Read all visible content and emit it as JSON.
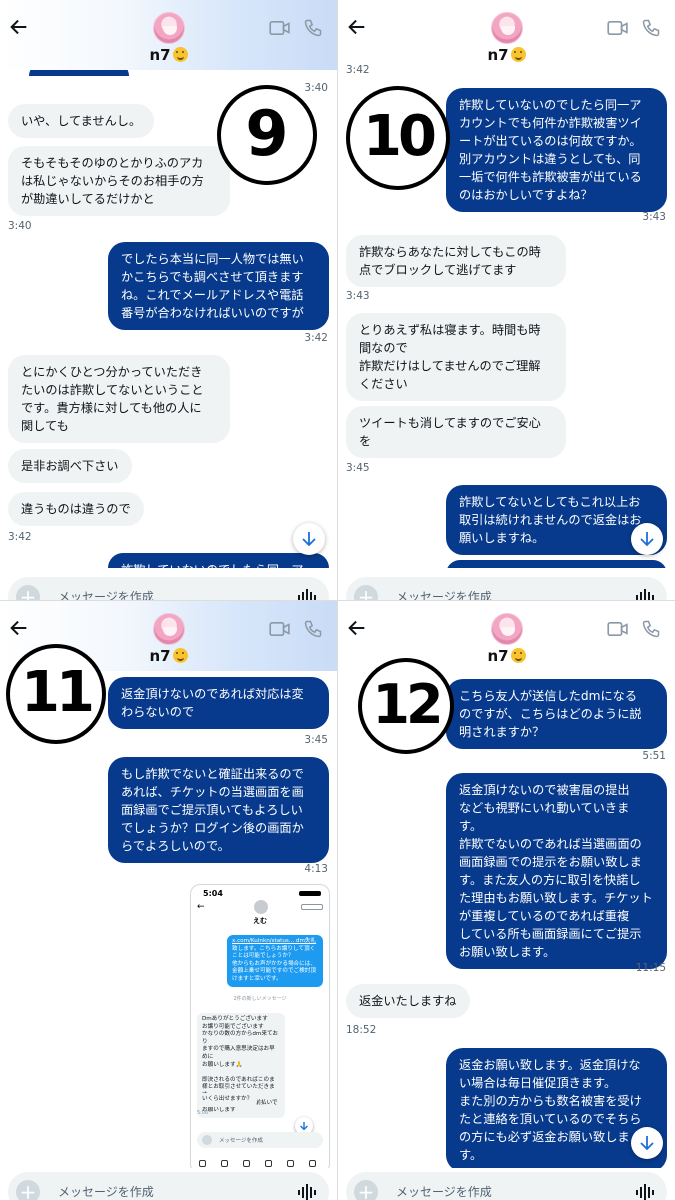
{
  "header": {
    "username": "n7",
    "emoji_icon": "tongue-wink-emoji-icon",
    "back_icon": "back-arrow-icon",
    "video_icon": "video-camera-icon",
    "phone_icon": "phone-icon"
  },
  "composer": {
    "placeholder": "メッセージを作成",
    "plus_icon": "plus-icon",
    "voice_icon": "voice-wave-icon"
  },
  "colors": {
    "outgoing_bubble": "#073a8c",
    "incoming_bubble": "#eff3f4",
    "timestamp": "#536471"
  },
  "panels": {
    "p9": {
      "number": "9",
      "top_time": "3:40",
      "messages": [
        {
          "dir": "in",
          "text": "いや、してませんし。"
        },
        {
          "dir": "in",
          "text": "そもそもそのゆのとかりふのアカ\nは私じゃないからそのお相手の方\nが勘違いしてるだけかと"
        },
        {
          "dir": "out",
          "text": "でしたら本当に同一人物では無い\nかこちらでも調べさせて頂きます\nね。これでメールアドレスや電話\n番号が合わなければいいのですが"
        },
        {
          "dir": "in",
          "text": "とにかくひとつ分かっていただき\nたいのは詐欺してないということ\nです。貴方様に対しても他の人に\n関しても"
        },
        {
          "dir": "in",
          "text": "是非お調べ下さい"
        },
        {
          "dir": "in",
          "text": "違うものは違うので"
        }
      ],
      "times": [
        "3:40",
        "3:42",
        "3:42"
      ],
      "cut_text": "詐欺していないのでしたら同一ア"
    },
    "p10": {
      "number": "10",
      "top_time": "3:42",
      "messages": [
        {
          "dir": "out",
          "text": "詐欺していないのでしたら同一ア\nカウントでも何件か詐欺被害ツイ\nートが出ているのは何故ですか。\n別アカウントは違うとしても、同\n一垢で何件も詐欺被害が出ている\nのはおかしいですよね？"
        },
        {
          "dir": "in",
          "text": "詐欺ならあなたに対してもこの時\n点でブロックして逃げてます"
        },
        {
          "dir": "in",
          "text": "とりあえず私は寝ます。時間も時\n間なので\n詐欺だけはしてませんのでご理解\nください"
        },
        {
          "dir": "in",
          "text": "ツイートも消してますのでご安心\nを"
        },
        {
          "dir": "out",
          "text": "詐欺してないとしてもこれ以上お\n取引は続けれませんので返金はお\n願いしますね。"
        }
      ],
      "times": [
        "3:43",
        "3:43",
        "3:45"
      ]
    },
    "p11": {
      "number": "11",
      "messages": [
        {
          "dir": "out",
          "text": "返金頂けないのであれば対応は変\nわらないので"
        },
        {
          "dir": "out",
          "text": "もし詐欺でないと確証出来るので\nあれば、チケットの当選画面を画\n面録画でご提示頂いてもよろしい\nでしょうか？ログイン後の画面か\nらでよろしいので。"
        }
      ],
      "times": [
        "3:45",
        "4:13"
      ],
      "embedded": {
        "status_time": "5:04",
        "contact_name": "えむ",
        "out_link": "x.com/Kuinkn/status... dm失礼",
        "out_text": "致します。こちらお譲りして頂く\nことは可能でしょうか？\n他からもお声がかかる場合には、\n金額上乗せ可能ですのでご検討頂\nけますと幸いです。",
        "out_time": "2月の新しいメッセージ",
        "separator": "2件の新しいメッセージ",
        "in_text": "Dmありがとうございます\nお譲り可能でございます\nかなりの数の方からdm来ており\nますので購入意思決定はお早めに\nお願いします🙏\n\n即決されるのであればこのま\n様とお取引させていただきます\nお支払いはPayPay事前払いで\nお願いします",
        "in_text2": "いくら出せますか？",
        "in_time": "5:06",
        "composer": "メッセージを作成"
      }
    },
    "p12": {
      "number": "12",
      "messages": [
        {
          "dir": "out",
          "text": "こちら友人が送信したdmになる\nのですが、こちらはどのように説\n明されますか？"
        },
        {
          "dir": "out",
          "text": "返金頂けないので被害届の提出\nなども視野にいれ動いていきま\nす。\n詐欺でないのであれば当選画面の\n画面録画での提示をお願い致しま\nす。また友人の方に取引を快諾し\nた理由もお願い致します。チケット\nが重複しているのであれば重複\nしている所も画面録画にてご提示\nお願い致します。"
        },
        {
          "dir": "in",
          "text": "返金いたしますね"
        },
        {
          "dir": "out",
          "text": "返金お願い致します。返金頂けな\nい場合は毎日催促頂きます。\nまた別の方からも数名被害を受け\nたと連絡を頂いているのでそちら\nの方にも必ず返金お願い致しま\nす。"
        }
      ],
      "times": [
        "5:51",
        "11:15",
        "18:52"
      ]
    }
  }
}
